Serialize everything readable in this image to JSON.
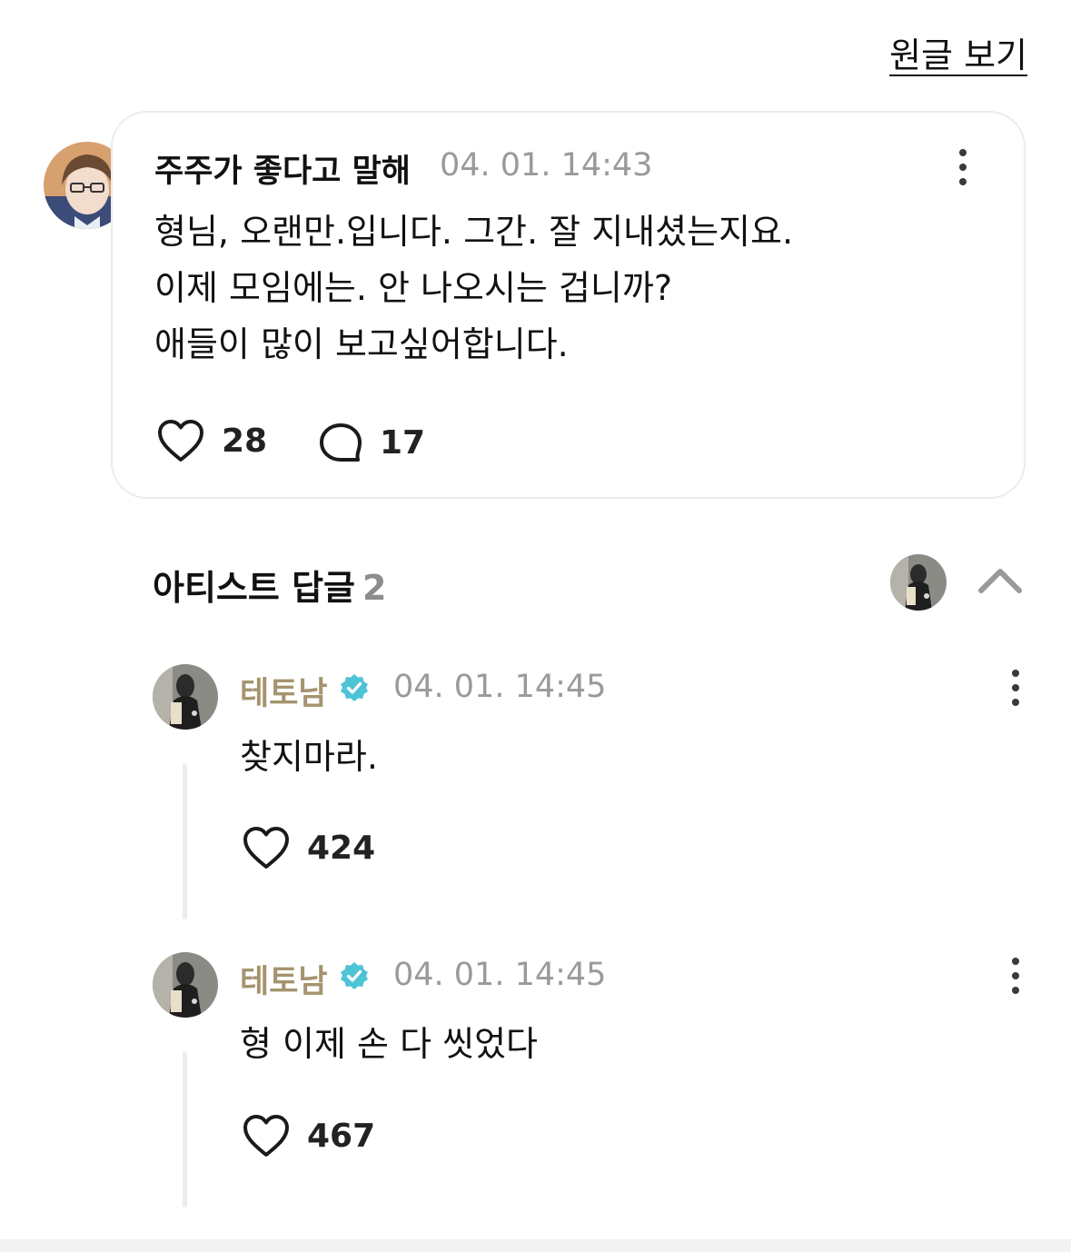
{
  "header": {
    "view_original": "원글 보기"
  },
  "post": {
    "author": "주주가 좋다고 말해",
    "timestamp": "04. 01. 14:43",
    "lines": [
      "형님, 오랜만.입니다. 그간. 잘 지내셨는지요.",
      "이제 모임에는. 안 나오시는 겁니까?",
      "애들이 많이 보고싶어합니다."
    ],
    "like_count": "28",
    "comment_count": "17"
  },
  "artist_replies": {
    "title": "아티스트 답글",
    "count": "2",
    "items": [
      {
        "author": "테토남",
        "timestamp": "04. 01. 14:45",
        "text": "찾지마라.",
        "like_count": "424"
      },
      {
        "author": "테토남",
        "timestamp": "04. 01. 14:45",
        "text": "형 이제 손 다 씻었다",
        "like_count": "467"
      }
    ]
  },
  "icons": {
    "like": "heart-icon",
    "comment": "speech-bubble-icon",
    "more": "kebab-menu-icon",
    "verified": "verified-badge-icon",
    "collapse": "chevron-up-icon"
  },
  "colors": {
    "artist_name": "#a4946e",
    "verified_badge": "#4ec3d6",
    "timestamp": "#9a9a9a"
  }
}
